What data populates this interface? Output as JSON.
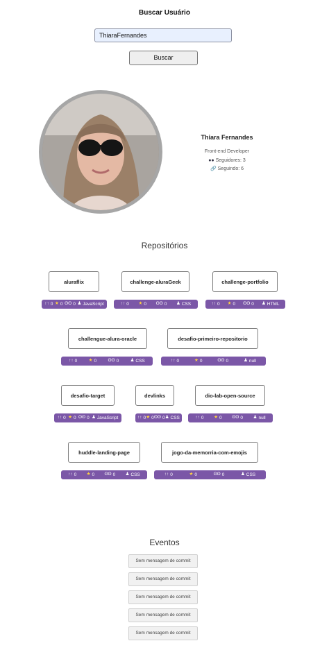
{
  "search": {
    "title": "Buscar Usuário",
    "value": "ThiaraFernandes",
    "button_label": "Buscar"
  },
  "profile": {
    "name": "Thiara Fernandes",
    "bio": "Front-end Developer",
    "followers": "Seguidores: 3",
    "following": "Seguindo: 6"
  },
  "repos_title": "Repositórios",
  "repos": [
    {
      "name": "aluraflix",
      "forks": "0",
      "stars": "0",
      "watchers": "0",
      "language": "JavaScript"
    },
    {
      "name": "challenge-aluraGeek",
      "forks": "0",
      "stars": "0",
      "watchers": "0",
      "language": "CSS"
    },
    {
      "name": "challenge-portfolio",
      "forks": "0",
      "stars": "0",
      "watchers": "0",
      "language": "HTML"
    },
    {
      "name": "challengue-alura-oracle",
      "forks": "0",
      "stars": "0",
      "watchers": "0",
      "language": "CSS"
    },
    {
      "name": "desafio-primeiro-repositorio",
      "forks": "0",
      "stars": "0",
      "watchers": "0",
      "language": "null"
    },
    {
      "name": "desafio-target",
      "forks": "0",
      "stars": "0",
      "watchers": "0",
      "language": "JavaScript"
    },
    {
      "name": "devlinks",
      "forks": "0",
      "stars": "0",
      "watchers": "0",
      "language": "CSS"
    },
    {
      "name": "dio-lab-open-source",
      "forks": "0",
      "stars": "0",
      "watchers": "0",
      "language": "null"
    },
    {
      "name": "huddle-landing-page",
      "forks": "0",
      "stars": "0",
      "watchers": "0",
      "language": "CSS"
    },
    {
      "name": "jogo-da-memorria-com-emojis",
      "forks": "0",
      "stars": "0",
      "watchers": "0",
      "language": "CSS"
    }
  ],
  "events_title": "Eventos",
  "events": [
    "Sem mensagem de commit",
    "Sem mensagem de commit",
    "Sem mensagem de commit",
    "Sem mensagem de commit",
    "Sem mensagem de commit"
  ],
  "icons": {
    "fork": "fork-icon",
    "star": "star-icon",
    "watchers": "eyes-icon",
    "language": "person-icon",
    "followers": "people-icon",
    "following": "link-icon"
  },
  "colors": {
    "stats_bar": "#7b57a7",
    "star": "#ffd23f",
    "input_bg": "#e8f0fe"
  }
}
